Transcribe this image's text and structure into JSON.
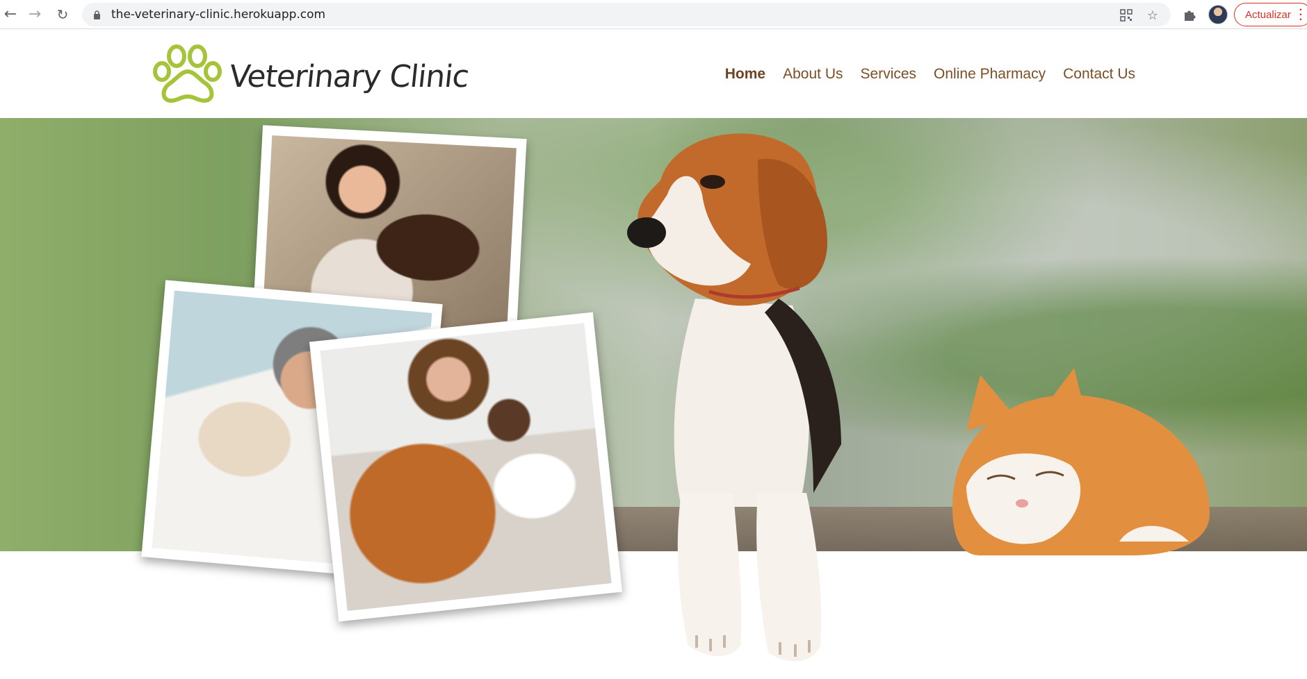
{
  "browser": {
    "url": "the-veterinary-clinic.herokuapp.com",
    "update_label": "Actualizar",
    "icons": [
      "back-arrow-icon",
      "forward-arrow-icon",
      "reload-icon",
      "lock-icon",
      "qr-code-icon",
      "star-icon",
      "puzzle-icon",
      "avatar"
    ]
  },
  "site": {
    "logo_text": "Veterinary Clinic",
    "brand_colors": {
      "logo_green": "#a6c43a",
      "nav_brown": "#7b4f25"
    },
    "nav": [
      {
        "label": "Home",
        "active": true
      },
      {
        "label": "About Us",
        "active": false
      },
      {
        "label": "Services",
        "active": false
      },
      {
        "label": "Online Pharmacy",
        "active": false
      },
      {
        "label": "Contact Us",
        "active": false
      }
    ]
  }
}
